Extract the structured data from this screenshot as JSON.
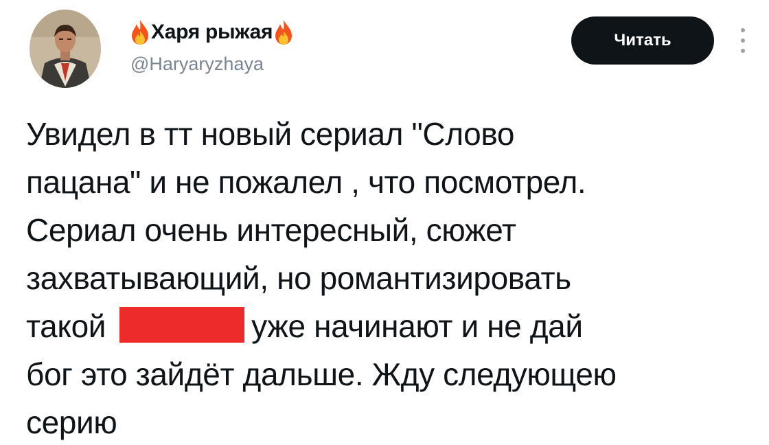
{
  "tweet": {
    "author": {
      "display_name": "Харя рыжая",
      "name_emoji_icon": "fire-icon",
      "handle": "@Haryaryzhaya",
      "avatar_icon": "avatar-portrait"
    },
    "follow_button_label": "Читать",
    "more_icon": "vertical-dots-icon",
    "text_lines": [
      "Увидел в тт новый сериал \"Слово",
      "пацана\" и не пожалел , что посмотрел.",
      "Сериал очень интересный, сюжет",
      "захватывающий, но романтизировать",
      "такой",
      "уже начинают и не дай",
      "бог это зайдёт дальше. Жду следующею",
      "серию"
    ],
    "redaction_color": "#ee2b2b"
  }
}
